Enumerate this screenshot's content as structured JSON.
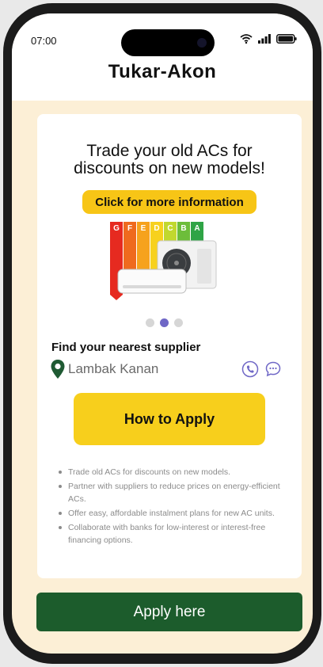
{
  "status_bar": {
    "time": "07:00"
  },
  "app": {
    "title": "Tukar-Akon"
  },
  "banner": {
    "headline_line1": "Trade your old ACs for",
    "headline_line2": "discounts on new models!",
    "info_button": "Click for more information",
    "energy_grades": [
      "G",
      "F",
      "E",
      "D",
      "C",
      "B",
      "A"
    ],
    "grade_colors": [
      "#e62a20",
      "#ef6a1e",
      "#f6a21d",
      "#f7d11e",
      "#c1d82f",
      "#6dbd3a",
      "#2fa446"
    ],
    "carousel": {
      "count": 3,
      "active_index": 1
    }
  },
  "supplier": {
    "title": "Find your nearest supplier",
    "location": "Lambak Kanan"
  },
  "how_to_apply_label": "How to Apply",
  "benefits": [
    "Trade old ACs for discounts on new models.",
    "Partner with suppliers to reduce prices on energy-efficient ACs.",
    "Offer easy, affordable instalment plans for new AC units.",
    "Collaborate with banks for low-interest or interest-free financing options."
  ],
  "apply_here_label": "Apply here",
  "colors": {
    "accent_yellow": "#f7c516",
    "primary_green": "#1c5c2c",
    "background_cream": "#fcefd6",
    "carousel_active": "#6f67c6"
  }
}
